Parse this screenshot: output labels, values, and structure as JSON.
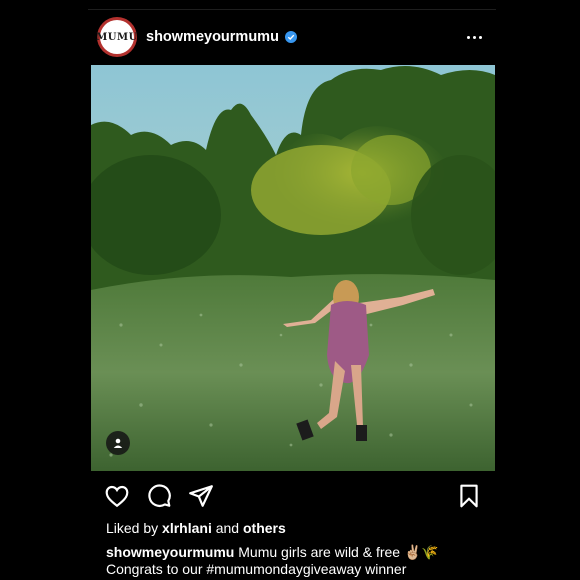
{
  "post": {
    "avatar_text": "MUMU",
    "username": "showmeyourmumu",
    "verified": true,
    "accent_color": "#3897f0",
    "avatar_ring_color": "#b3312e"
  },
  "icons": {
    "more": "more-options-icon",
    "like": "heart-icon",
    "comment": "comment-icon",
    "share": "send-icon",
    "save": "bookmark-icon",
    "tag": "user-tag-icon"
  },
  "likes": {
    "prefix": "Liked by",
    "user": "xlrhlani",
    "conjunction": "and",
    "others": "others"
  },
  "caption": {
    "username": "showmeyourmumu",
    "line1": "Mumu girls are wild & free ✌🏼🌾",
    "line2": "Congrats to our #mumumondaygiveaway winner"
  }
}
